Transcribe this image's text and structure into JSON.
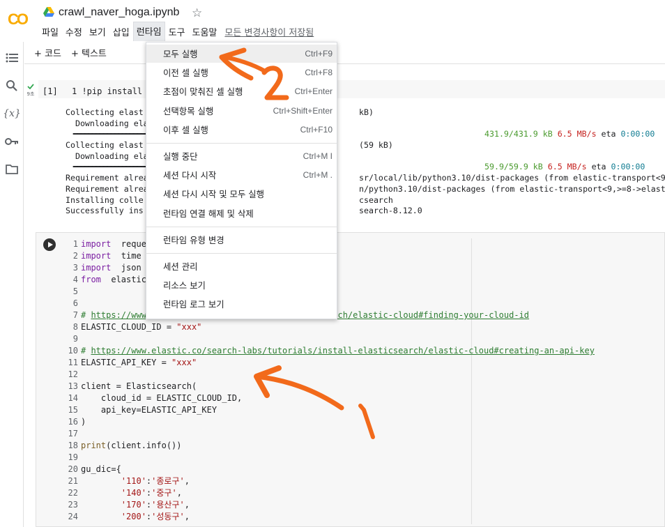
{
  "app": {
    "logo_text": "CO",
    "title": "crawl_naver_hoga.ipynb",
    "star_glyph": "☆",
    "save_status": "모든 변경사항이 저장됨",
    "brand_color": "#f9ab00"
  },
  "menubar": [
    "파일",
    "수정",
    "보기",
    "삽입",
    "런타임",
    "도구",
    "도움말"
  ],
  "toolbar": {
    "add_code": "+ 코드",
    "add_text": "+ 텍스트"
  },
  "rail_icons": [
    "toc-icon",
    "search-icon",
    "variables-icon",
    "key-icon",
    "folder-icon"
  ],
  "rail_variables_glyph": "{x}",
  "runtime_menu": {
    "groups": [
      [
        {
          "label": "모두 실행",
          "shortcut": "Ctrl+F9"
        },
        {
          "label": "이전 셀 실행",
          "shortcut": "Ctrl+F8"
        },
        {
          "label": "초점이 맞춰진 셀 실행",
          "shortcut": "Ctrl+Enter"
        },
        {
          "label": "선택항목 실행",
          "shortcut": "Ctrl+Shift+Enter"
        },
        {
          "label": "이후 셀 실행",
          "shortcut": "Ctrl+F10"
        }
      ],
      [
        {
          "label": "실행 중단",
          "shortcut": "Ctrl+M I"
        },
        {
          "label": "세션 다시 시작",
          "shortcut": "Ctrl+M ."
        },
        {
          "label": "세션 다시 시작 및 모두 실행",
          "shortcut": ""
        },
        {
          "label": "런타임 연결 해제 및 삭제",
          "shortcut": ""
        }
      ],
      [
        {
          "label": "런타임 유형 변경",
          "shortcut": ""
        }
      ],
      [
        {
          "label": "세션 관리",
          "shortcut": ""
        },
        {
          "label": "리소스 보기",
          "shortcut": ""
        },
        {
          "label": "런타임 로그 보기",
          "shortcut": ""
        }
      ]
    ]
  },
  "cell1": {
    "run_time": "9초",
    "exec_count": "[1]",
    "code_line": "1 !pip install e",
    "output": [
      {
        "left": "Collecting elast",
        "right": "kB)"
      },
      {
        "left": "  Downloading ela",
        "right": ""
      },
      {
        "left": "",
        "right": "",
        "progress": "431.9/431.9 kB",
        "speed": "6.5 MB/s",
        "eta_label": "eta",
        "eta": "0:00:00"
      },
      {
        "left": "Collecting elast",
        "right": "(59 kB)"
      },
      {
        "left": "  Downloading ela",
        "right": ""
      },
      {
        "left": "",
        "right": "",
        "progress": "59.9/59.9 kB",
        "speed": "6.5 MB/s",
        "eta_label": "eta",
        "eta": "0:00:00"
      },
      {
        "left": "Requirement alrea",
        "right": "sr/local/lib/python3.10/dist-packages (from elastic-transport<9,>=8-"
      },
      {
        "left": "Requirement alrea",
        "right": "n/python3.10/dist-packages (from elastic-transport<9,>=8->elasticsea"
      },
      {
        "left": "Installing colle",
        "right": "csearch"
      },
      {
        "left": "Successfully ins",
        "right": "search-8.12.0"
      }
    ]
  },
  "cell2": {
    "lines": [
      {
        "n": "1",
        "parts": [
          [
            "kw",
            "import"
          ],
          [
            "",
            "  request"
          ]
        ]
      },
      {
        "n": "2",
        "parts": [
          [
            "kw",
            "import"
          ],
          [
            "",
            "  time"
          ]
        ]
      },
      {
        "n": "3",
        "parts": [
          [
            "kw",
            "import"
          ],
          [
            "",
            "  json"
          ]
        ]
      },
      {
        "n": "4",
        "parts": [
          [
            "kw",
            "from"
          ],
          [
            "",
            "  elasticse"
          ]
        ]
      },
      {
        "n": "5",
        "parts": []
      },
      {
        "n": "6",
        "parts": []
      },
      {
        "n": "7",
        "parts": [
          [
            "cm",
            "# "
          ],
          [
            "lnk",
            "https://www"
          ],
          [
            "",
            "                         "
          ],
          [
            "lnk",
            "l-elasticsearch/elastic-cloud#finding-your-cloud-id"
          ]
        ]
      },
      {
        "n": "8",
        "parts": [
          [
            "",
            "ELASTIC_CLOUD_ID = "
          ],
          [
            "str",
            "\"xxx\""
          ]
        ]
      },
      {
        "n": "9",
        "parts": []
      },
      {
        "n": "10",
        "parts": [
          [
            "cm",
            "# "
          ],
          [
            "lnk",
            "https://www.elastic.co/search-labs/tutorials/install-elasticsearch/elastic-cloud#creating-an-api-key"
          ]
        ]
      },
      {
        "n": "11",
        "parts": [
          [
            "",
            "ELASTIC_API_KEY = "
          ],
          [
            "str",
            "\"xxx\""
          ]
        ]
      },
      {
        "n": "12",
        "parts": []
      },
      {
        "n": "13",
        "parts": [
          [
            "",
            "client = Elasticsearch("
          ]
        ]
      },
      {
        "n": "14",
        "parts": [
          [
            "",
            "    cloud_id = ELASTIC_CLOUD_ID,"
          ]
        ]
      },
      {
        "n": "15",
        "parts": [
          [
            "",
            "    api_key=ELASTIC_API_KEY"
          ]
        ]
      },
      {
        "n": "16",
        "parts": [
          [
            "",
            ")"
          ]
        ]
      },
      {
        "n": "17",
        "parts": []
      },
      {
        "n": "18",
        "parts": [
          [
            "fn",
            "print"
          ],
          [
            "",
            "(client.info())"
          ]
        ]
      },
      {
        "n": "19",
        "parts": []
      },
      {
        "n": "20",
        "parts": [
          [
            "",
            "gu_dic={"
          ]
        ]
      },
      {
        "n": "21",
        "parts": [
          [
            "",
            "        "
          ],
          [
            "str",
            "'110'"
          ],
          [
            "",
            ":"
          ],
          [
            "str",
            "'종로구'"
          ],
          [
            "",
            ","
          ]
        ]
      },
      {
        "n": "22",
        "parts": [
          [
            "",
            "        "
          ],
          [
            "str",
            "'140'"
          ],
          [
            "",
            ":"
          ],
          [
            "str",
            "'중구'"
          ],
          [
            "",
            ","
          ]
        ]
      },
      {
        "n": "23",
        "parts": [
          [
            "",
            "        "
          ],
          [
            "str",
            "'170'"
          ],
          [
            "",
            ":"
          ],
          [
            "str",
            "'용산구'"
          ],
          [
            "",
            ","
          ]
        ]
      },
      {
        "n": "24",
        "parts": [
          [
            "",
            "        "
          ],
          [
            "str",
            "'200'"
          ],
          [
            "",
            ":"
          ],
          [
            "str",
            "'성동구'"
          ],
          [
            "",
            ","
          ]
        ]
      }
    ]
  },
  "annotations": {
    "color": "#f26a1b"
  }
}
